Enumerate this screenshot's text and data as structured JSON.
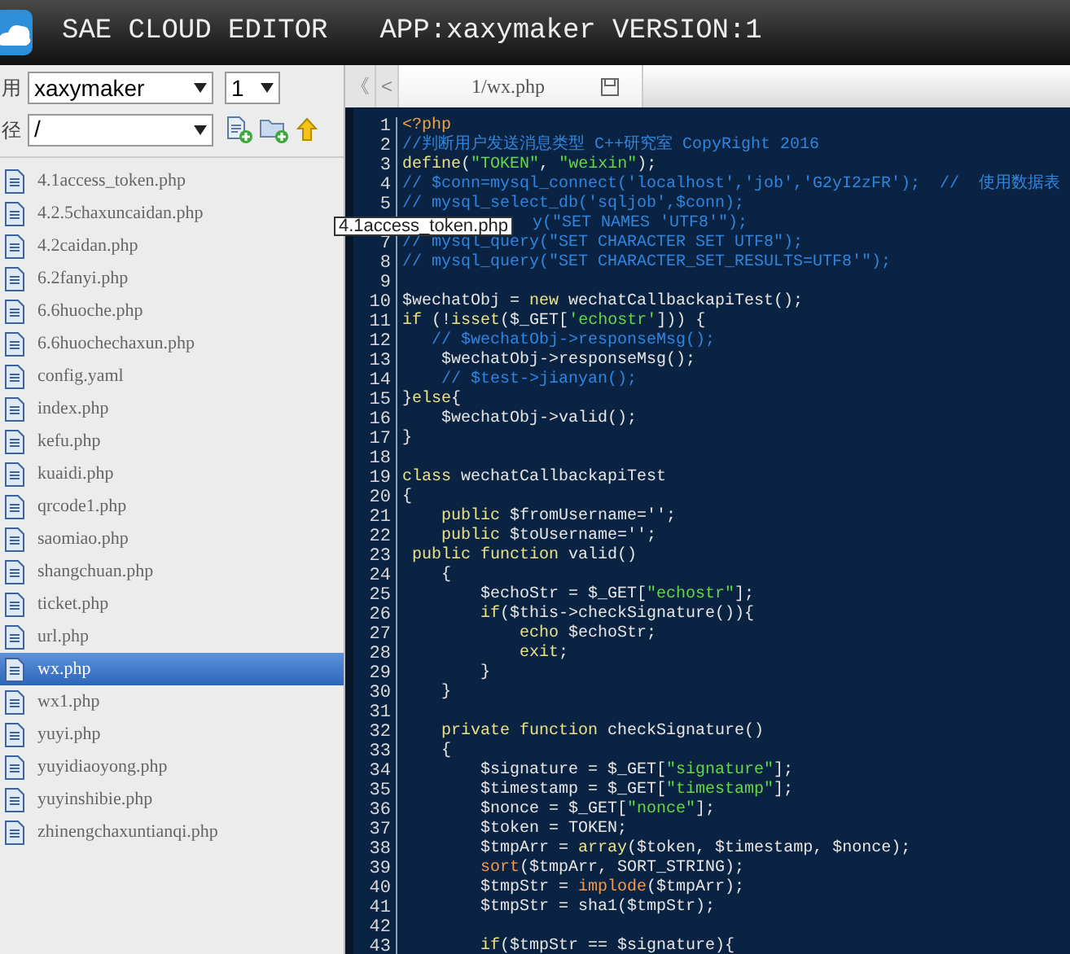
{
  "header": {
    "title": "SAE CLOUD EDITOR",
    "app_info": "APP:xaxymaker VERSION:1"
  },
  "toolbar": {
    "app_label": "用",
    "app_select": "xaxymaker",
    "version_select": "1",
    "path_label": "径",
    "path_select": "/"
  },
  "files": [
    {
      "name": "4.1access_token.php",
      "selected": false
    },
    {
      "name": "4.2.5chaxuncaidan.php",
      "selected": false
    },
    {
      "name": "4.2caidan.php",
      "selected": false
    },
    {
      "name": "6.2fanyi.php",
      "selected": false
    },
    {
      "name": "6.6huoche.php",
      "selected": false
    },
    {
      "name": "6.6huochechaxun.php",
      "selected": false
    },
    {
      "name": "config.yaml",
      "selected": false
    },
    {
      "name": "index.php",
      "selected": false
    },
    {
      "name": "kefu.php",
      "selected": false
    },
    {
      "name": "kuaidi.php",
      "selected": false
    },
    {
      "name": "qrcode1.php",
      "selected": false
    },
    {
      "name": "saomiao.php",
      "selected": false
    },
    {
      "name": "shangchuan.php",
      "selected": false
    },
    {
      "name": "ticket.php",
      "selected": false
    },
    {
      "name": "url.php",
      "selected": false
    },
    {
      "name": "wx.php",
      "selected": true
    },
    {
      "name": "wx1.php",
      "selected": false
    },
    {
      "name": "yuyi.php",
      "selected": false
    },
    {
      "name": "yuyidiaoyong.php",
      "selected": false
    },
    {
      "name": "yuyinshibie.php",
      "selected": false
    },
    {
      "name": "zhinengchaxuntianqi.php",
      "selected": false
    }
  ],
  "tooltip": "4.1access_token.php",
  "editor": {
    "nav": [
      "《",
      "<"
    ],
    "tab": "1/wx.php",
    "lines": [
      {
        "number": "1",
        "parts": [
          {
            "kind": "tag",
            "text": "<?php"
          }
        ]
      },
      {
        "number": "2",
        "parts": [
          {
            "kind": "comment",
            "text": "//判断用户发送消息类型 C++研究室 CopyRight 2016"
          }
        ]
      },
      {
        "number": "3",
        "parts": [
          {
            "kind": "keyword",
            "text": "define"
          },
          {
            "kind": "plain",
            "text": "("
          },
          {
            "kind": "string",
            "text": "\"TOKEN\""
          },
          {
            "kind": "plain",
            "text": ", "
          },
          {
            "kind": "string",
            "text": "\"weixin\""
          },
          {
            "kind": "plain",
            "text": ");"
          }
        ]
      },
      {
        "number": "4",
        "parts": [
          {
            "kind": "comment",
            "text": "// $conn=mysql_connect('localhost','job','G2yI2zFR');  //  使用数据表"
          }
        ]
      },
      {
        "number": "5",
        "parts": [
          {
            "kind": "comment",
            "text": "// mysql_select_db('sqljob',$conn);"
          }
        ]
      },
      {
        "kind": "covered",
        "parts": [
          {
            "kind": "comment",
            "text": "y(\"SET NAMES 'UTF8'\");"
          }
        ]
      },
      {
        "number": "7",
        "parts": [
          {
            "kind": "comment",
            "text": "// mysql_query(\"SET CHARACTER SET UTF8\");"
          }
        ]
      },
      {
        "number": "8",
        "parts": [
          {
            "kind": "comment",
            "text": "// mysql_query(\"SET CHARACTER_SET_RESULTS=UTF8'\");"
          }
        ]
      },
      {
        "number": "9"
      },
      {
        "number": "10",
        "parts": [
          {
            "kind": "plain",
            "text": "$wechatObj = "
          },
          {
            "kind": "keyword",
            "text": "new"
          },
          {
            "kind": "plain",
            "text": " wechatCallbackapiTest();"
          }
        ]
      },
      {
        "number": "11",
        "parts": [
          {
            "kind": "keyword",
            "text": "if"
          },
          {
            "kind": "plain",
            "text": " (!"
          },
          {
            "kind": "keyword",
            "text": "isset"
          },
          {
            "kind": "plain",
            "text": "($_GET["
          },
          {
            "kind": "string",
            "text": "'echostr'"
          },
          {
            "kind": "plain",
            "text": "])) {"
          }
        ]
      },
      {
        "number": "12",
        "parts": [
          {
            "kind": "comment",
            "text": "   // $wechatObj->responseMsg();"
          }
        ]
      },
      {
        "number": "13",
        "parts": [
          {
            "kind": "plain",
            "text": "    $wechatObj->responseMsg();"
          }
        ]
      },
      {
        "number": "14",
        "parts": [
          {
            "kind": "comment",
            "text": "    // $test->jianyan();"
          }
        ]
      },
      {
        "number": "15",
        "parts": [
          {
            "kind": "plain",
            "text": "}"
          },
          {
            "kind": "keyword",
            "text": "else"
          },
          {
            "kind": "plain",
            "text": "{"
          }
        ]
      },
      {
        "number": "16",
        "parts": [
          {
            "kind": "plain",
            "text": "    $wechatObj->valid();"
          }
        ]
      },
      {
        "number": "17",
        "parts": [
          {
            "kind": "plain",
            "text": "}"
          }
        ]
      },
      {
        "number": "18"
      },
      {
        "number": "19",
        "parts": [
          {
            "kind": "keyword",
            "text": "class"
          },
          {
            "kind": "plain",
            "text": " wechatCallbackapiTest"
          }
        ]
      },
      {
        "number": "20",
        "parts": [
          {
            "kind": "plain",
            "text": "{"
          }
        ]
      },
      {
        "number": "21",
        "parts": [
          {
            "kind": "keyword",
            "text": "    public"
          },
          {
            "kind": "plain",
            "text": " $fromUsername='';"
          }
        ]
      },
      {
        "number": "22",
        "parts": [
          {
            "kind": "keyword",
            "text": "    public"
          },
          {
            "kind": "plain",
            "text": " $toUsername='';"
          }
        ]
      },
      {
        "number": "23",
        "parts": [
          {
            "kind": "keyword",
            "text": " public function"
          },
          {
            "kind": "plain",
            "text": " valid()"
          }
        ]
      },
      {
        "number": "24",
        "parts": [
          {
            "kind": "plain",
            "text": "    {"
          }
        ]
      },
      {
        "number": "25",
        "parts": [
          {
            "kind": "plain",
            "text": "        $echoStr = $_GET["
          },
          {
            "kind": "string",
            "text": "\"echostr\""
          },
          {
            "kind": "plain",
            "text": "];"
          }
        ]
      },
      {
        "number": "26",
        "parts": [
          {
            "kind": "keyword",
            "text": "        if"
          },
          {
            "kind": "plain",
            "text": "($this->checkSignature()){"
          }
        ]
      },
      {
        "number": "27",
        "parts": [
          {
            "kind": "keyword",
            "text": "            echo"
          },
          {
            "kind": "plain",
            "text": " $echoStr;"
          }
        ]
      },
      {
        "number": "28",
        "parts": [
          {
            "kind": "keyword",
            "text": "            exit"
          },
          {
            "kind": "plain",
            "text": ";"
          }
        ]
      },
      {
        "number": "29",
        "parts": [
          {
            "kind": "plain",
            "text": "        }"
          }
        ]
      },
      {
        "number": "30",
        "parts": [
          {
            "kind": "plain",
            "text": "    }"
          }
        ]
      },
      {
        "number": "31"
      },
      {
        "number": "32",
        "parts": [
          {
            "kind": "keyword",
            "text": "    private function"
          },
          {
            "kind": "plain",
            "text": " checkSignature()"
          }
        ]
      },
      {
        "number": "33",
        "parts": [
          {
            "kind": "plain",
            "text": "    {"
          }
        ]
      },
      {
        "number": "34",
        "parts": [
          {
            "kind": "plain",
            "text": "        $signature = $_GET["
          },
          {
            "kind": "string",
            "text": "\"signature\""
          },
          {
            "kind": "plain",
            "text": "];"
          }
        ]
      },
      {
        "number": "35",
        "parts": [
          {
            "kind": "plain",
            "text": "        $timestamp = $_GET["
          },
          {
            "kind": "string",
            "text": "\"timestamp\""
          },
          {
            "kind": "plain",
            "text": "];"
          }
        ]
      },
      {
        "number": "36",
        "parts": [
          {
            "kind": "plain",
            "text": "        $nonce = $_GET["
          },
          {
            "kind": "string",
            "text": "\"nonce\""
          },
          {
            "kind": "plain",
            "text": "];"
          }
        ]
      },
      {
        "number": "37",
        "parts": [
          {
            "kind": "plain",
            "text": "        $token = TOKEN;"
          }
        ]
      },
      {
        "number": "38",
        "parts": [
          {
            "kind": "plain",
            "text": "        $tmpArr = "
          },
          {
            "kind": "keyword",
            "text": "array"
          },
          {
            "kind": "plain",
            "text": "($token, $timestamp, $nonce);"
          }
        ]
      },
      {
        "number": "39",
        "parts": [
          {
            "kind": "function",
            "text": "        sort"
          },
          {
            "kind": "plain",
            "text": "($tmpArr, SORT_STRING);"
          }
        ]
      },
      {
        "number": "40",
        "parts": [
          {
            "kind": "plain",
            "text": "        $tmpStr = "
          },
          {
            "kind": "function",
            "text": "implode"
          },
          {
            "kind": "plain",
            "text": "($tmpArr);"
          }
        ]
      },
      {
        "number": "41",
        "parts": [
          {
            "kind": "plain",
            "text": "        $tmpStr = sha1($tmpStr);"
          }
        ]
      },
      {
        "number": "42"
      },
      {
        "number": "43",
        "parts": [
          {
            "kind": "keyword",
            "text": "        if"
          },
          {
            "kind": "plain",
            "text": "($tmpStr == $signature){"
          }
        ]
      }
    ]
  }
}
